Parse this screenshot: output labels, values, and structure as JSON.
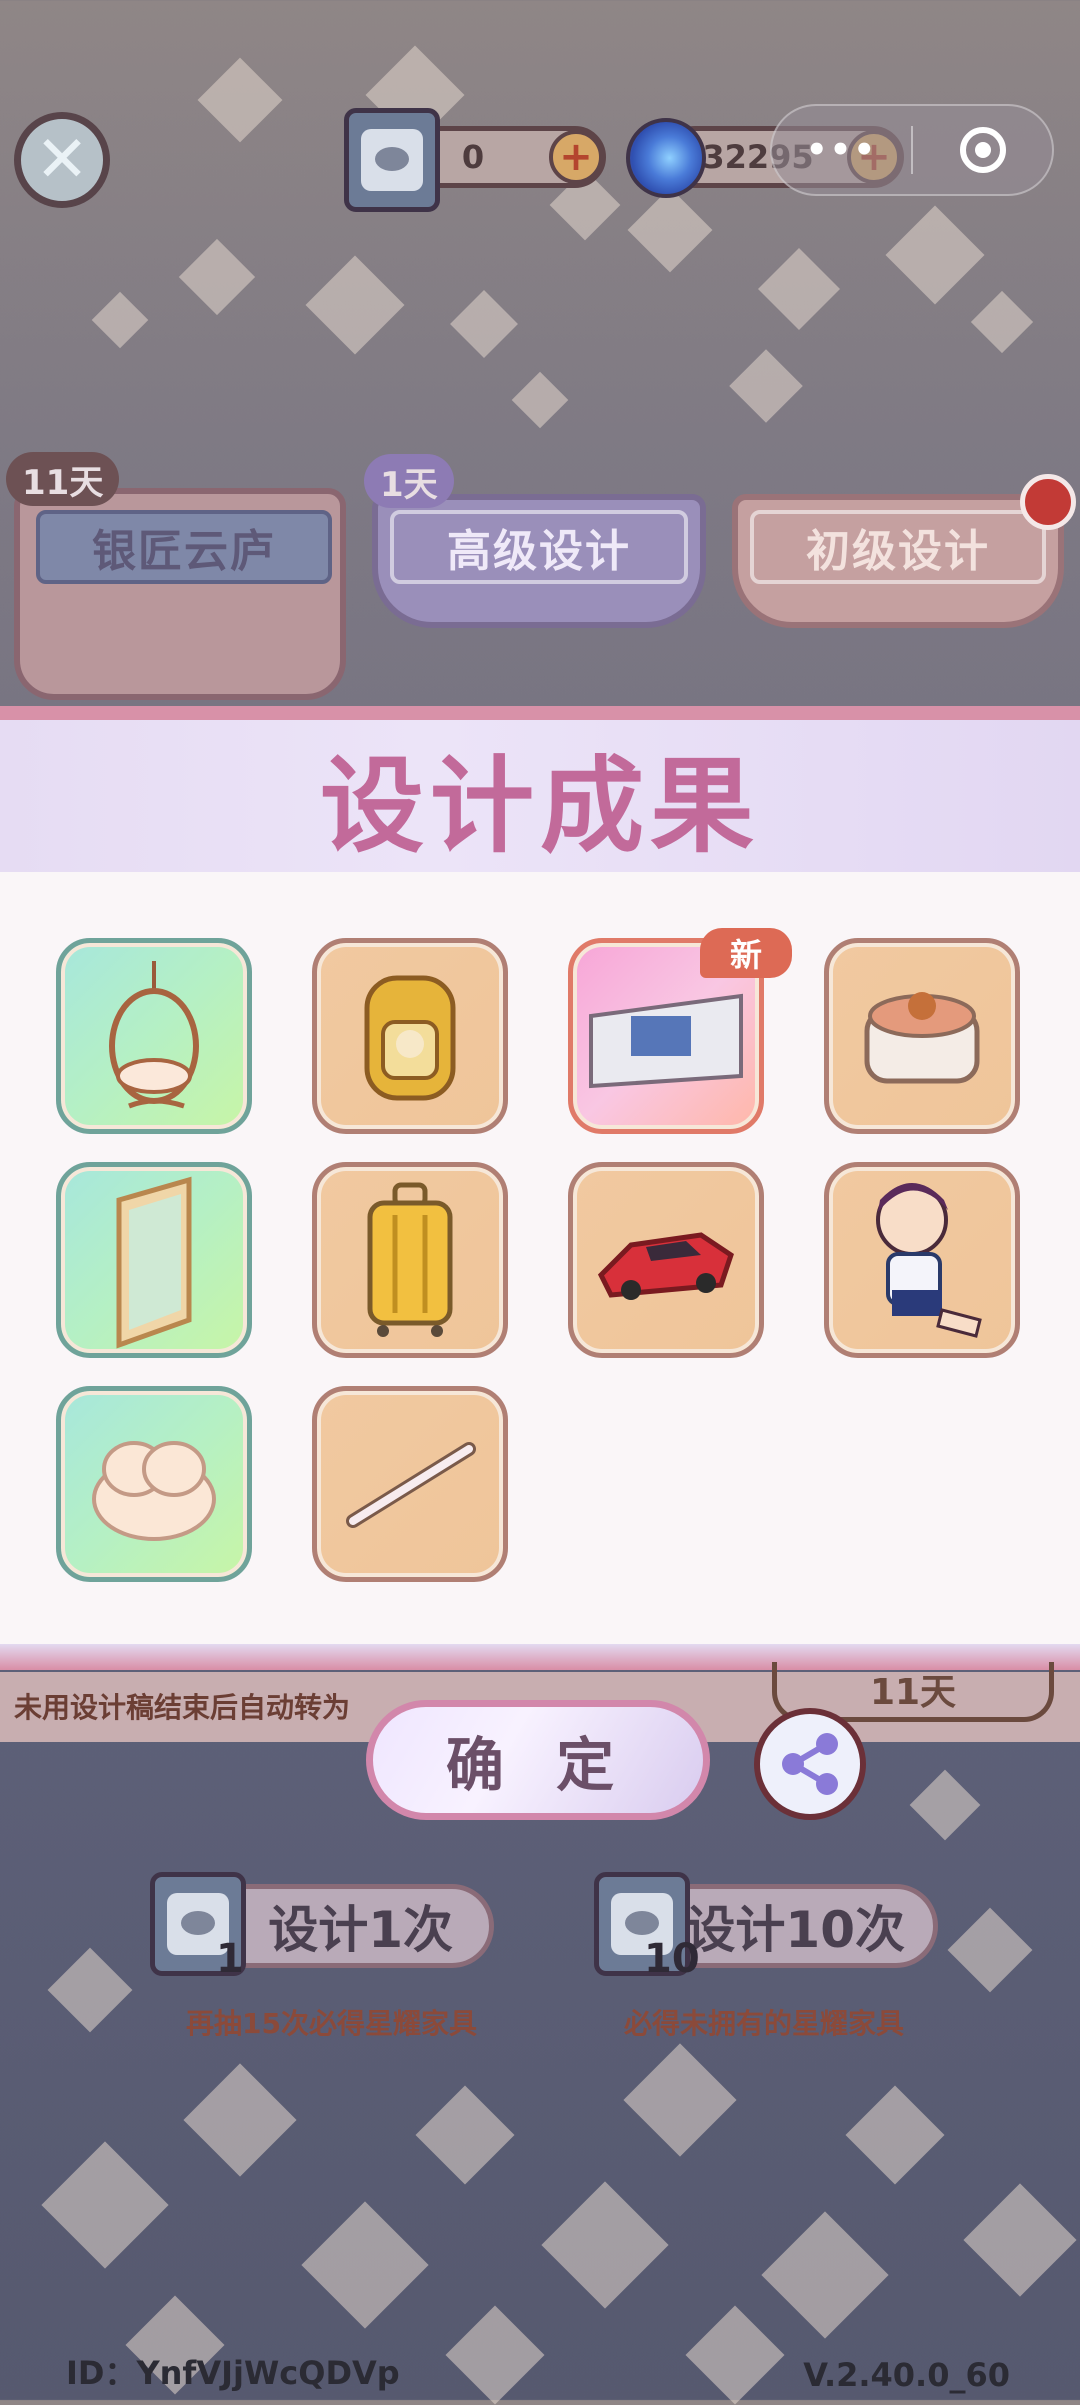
{
  "top_bar": {
    "ticket_count": "0",
    "currency_amount": "32295",
    "more_label": "•••"
  },
  "banners": [
    {
      "name": "银匠云庐",
      "days_left": "11天"
    },
    {
      "name": "高级设计",
      "days_left": "1天"
    },
    {
      "name": "初级设计"
    }
  ],
  "result_modal": {
    "title": "设计成果",
    "items": [
      {
        "icon": "hanging-egg-chair",
        "rarity": "green"
      },
      {
        "icon": "yellow-backpack",
        "rarity": "orange"
      },
      {
        "icon": "banner-wall-decor",
        "rarity": "pink",
        "badge": "新"
      },
      {
        "icon": "hot-pot",
        "rarity": "orange"
      },
      {
        "icon": "tall-mirror",
        "rarity": "green"
      },
      {
        "icon": "yellow-suitcase",
        "rarity": "orange"
      },
      {
        "icon": "red-sports-car-toy",
        "rarity": "orange"
      },
      {
        "icon": "boy-doll",
        "rarity": "orange"
      },
      {
        "icon": "cloud-cushion",
        "rarity": "green"
      },
      {
        "icon": "wooden-stick",
        "rarity": "orange"
      }
    ],
    "confirm_label": "确 定"
  },
  "notice": "未用设计稿结束后自动转为",
  "partial_pill": "11天",
  "draw": {
    "single": {
      "label": "设计1次",
      "cost": "1",
      "hint": "再抽15次必得星耀家具"
    },
    "ten": {
      "label": "设计10次",
      "cost": "10",
      "hint": "必得未拥有的星耀家具"
    }
  },
  "footer": {
    "user_id": "ID：YnfVJjWcQDVp",
    "version": "V.2.40.0_60"
  },
  "colors": {
    "modal_title": "#c26a9a",
    "modal_border": "#d891a8",
    "new_badge": "#dd6a55"
  }
}
